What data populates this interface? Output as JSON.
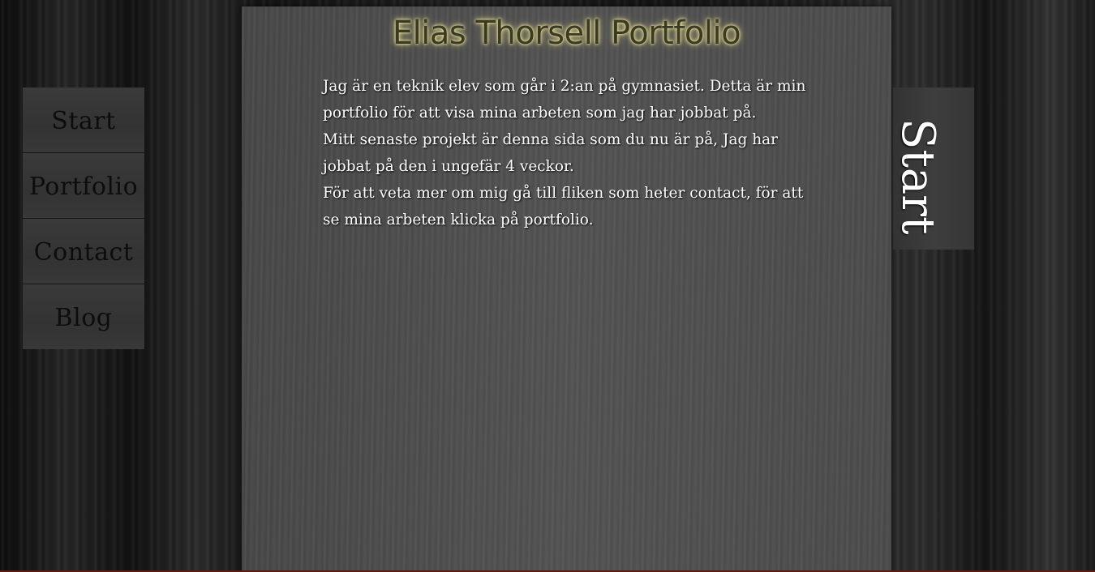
{
  "header": {
    "title": "Elias Thorsell Portfolio"
  },
  "sidebar": {
    "items": [
      {
        "label": "Start"
      },
      {
        "label": "Portfolio"
      },
      {
        "label": "Contact"
      },
      {
        "label": "Blog"
      }
    ]
  },
  "main": {
    "paragraphs": [
      "Jag är en teknik elev som går i 2:an på gymnasiet. Detta är min portfolio för att visa mina arbeten som jag har jobbat på.",
      "Mitt senaste projekt är denna sida som du nu är på, Jag har jobbat på den i ungefär 4 veckor.",
      "För att veta mer om mig gå till fliken som heter contact, för att se mina arbeten klicka på portfolio."
    ]
  },
  "side_tab": {
    "label": "Start"
  },
  "colors": {
    "title_glow": "#cfc57a",
    "nav_text": "#0d0d0d",
    "body_text": "#ffffff"
  }
}
